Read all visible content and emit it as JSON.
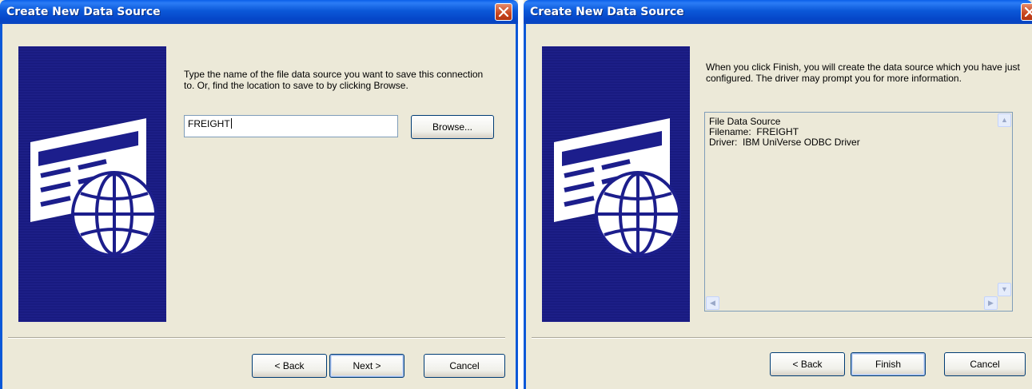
{
  "dialog1": {
    "title": "Create New Data Source",
    "prompt": "Type the name of the file data source you want to save this connection to.  Or, find the location to save to by clicking Browse.",
    "filename_value": "FREIGHT",
    "browse_label": "Browse...",
    "back_label": "< Back",
    "next_label": "Next >",
    "cancel_label": "Cancel"
  },
  "dialog2": {
    "title": "Create New Data Source",
    "prompt": "When you click Finish, you will create the data source which you have just configured.  The driver may prompt you for more information.",
    "summary": {
      "line1": "File Data Source",
      "line2": "Filename:  FREIGHT",
      "line3": "Driver:  IBM UniVerse ODBC Driver"
    },
    "back_label": "< Back",
    "finish_label": "Finish",
    "cancel_label": "Cancel"
  },
  "icons": [
    "close-icon",
    "data-source-globe-icon",
    "scroll-up-arrow-icon",
    "scroll-down-arrow-icon",
    "scroll-left-arrow-icon",
    "scroll-right-arrow-icon"
  ],
  "colors": {
    "titlebar": "#0b58d8",
    "dialog_bg": "#ece9d8",
    "bitmap_bg": "#1c1e8c",
    "close_button": "#c9461f"
  }
}
